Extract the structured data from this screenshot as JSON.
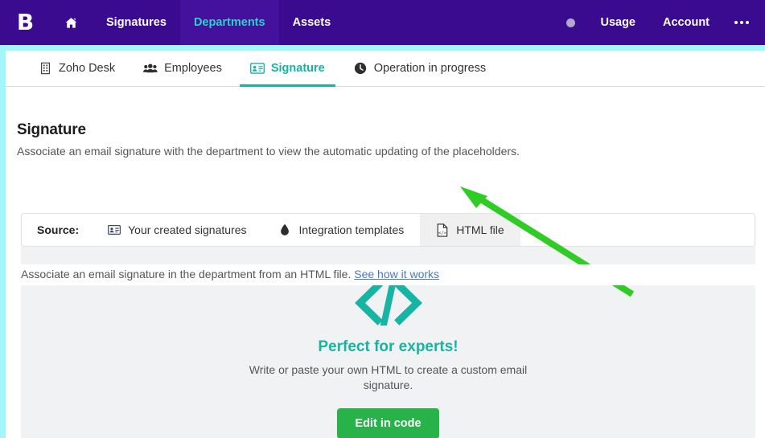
{
  "topnav": {
    "brand_letter": "B",
    "home_icon": "home-icon",
    "items": [
      {
        "label": "Signatures",
        "active": false
      },
      {
        "label": "Departments",
        "active": true
      },
      {
        "label": "Assets",
        "active": false
      }
    ],
    "right_items": [
      {
        "label": "Usage"
      },
      {
        "label": "Account"
      }
    ],
    "dot_indicator": "status-dot-icon",
    "more_icon": "more-horizontal-icon",
    "background_color": "#3b0b8f",
    "active_color": "#2ad2c9"
  },
  "subtabs": [
    {
      "label": "Zoho Desk",
      "icon": "building-icon",
      "active": false
    },
    {
      "label": "Employees",
      "icon": "people-icon",
      "active": false
    },
    {
      "label": "Signature",
      "icon": "contact-card-icon",
      "active": true
    },
    {
      "label": "Operation in progress",
      "icon": "clock-icon",
      "active": false
    }
  ],
  "heading": {
    "title": "Signature",
    "subtitle": "Associate an email signature with the department to view the automatic updating of the placeholders."
  },
  "source_bar": {
    "label": "Source:",
    "options": [
      {
        "label": "Your created signatures",
        "icon": "contact-card-icon",
        "selected": false
      },
      {
        "label": "Integration templates",
        "icon": "droplet-icon",
        "selected": false
      },
      {
        "label": "HTML file",
        "icon": "html-file-icon",
        "selected": true
      }
    ]
  },
  "helper": {
    "text": "Associate an email signature in the department from an HTML file.",
    "link_label": "See how it works"
  },
  "empty_panel": {
    "icon": "code-brackets-icon",
    "title": "Perfect for experts!",
    "description": "Write or paste your own HTML to create a custom email signature.",
    "button_label": "Edit in code",
    "accent_color": "#17b3a3",
    "button_color": "#28b24a",
    "background_color": "#f1f2f4"
  },
  "annotation": {
    "arrow": "green-arrow-pointer",
    "color": "#2fcc26",
    "points_to": "HTML file"
  }
}
